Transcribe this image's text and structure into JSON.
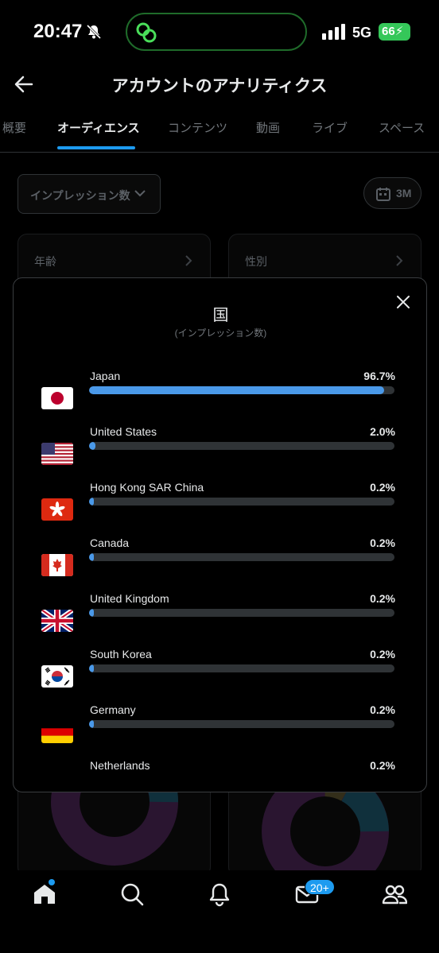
{
  "status_bar": {
    "time": "20:47",
    "network": "5G",
    "battery": "66"
  },
  "header": {
    "title": "アカウントのアナリティクス"
  },
  "tabs": [
    {
      "label": "概要"
    },
    {
      "label": "オーディエンス"
    },
    {
      "label": "コンテンツ"
    },
    {
      "label": "動画"
    },
    {
      "label": "ライブ"
    },
    {
      "label": "スペース"
    }
  ],
  "filters": {
    "metric": "インプレッション数",
    "range": "3M"
  },
  "cards": [
    {
      "title": "年齢"
    },
    {
      "title": "性別"
    }
  ],
  "modal": {
    "title": "国",
    "subtitle": "(インプレッション数)",
    "rows": [
      {
        "country": "Japan",
        "percent_label": "96.7%",
        "percent": 96.7,
        "flag": "japan-flag-icon"
      },
      {
        "country": "United States",
        "percent_label": "2.0%",
        "percent": 2.0,
        "flag": "us-flag-icon"
      },
      {
        "country": "Hong Kong SAR China",
        "percent_label": "0.2%",
        "percent": 0.2,
        "flag": "hong-kong-flag-icon"
      },
      {
        "country": "Canada",
        "percent_label": "0.2%",
        "percent": 0.2,
        "flag": "canada-flag-icon"
      },
      {
        "country": "United Kingdom",
        "percent_label": "0.2%",
        "percent": 0.2,
        "flag": "uk-flag-icon"
      },
      {
        "country": "South Korea",
        "percent_label": "0.2%",
        "percent": 0.2,
        "flag": "south-korea-flag-icon"
      },
      {
        "country": "Germany",
        "percent_label": "0.2%",
        "percent": 0.2,
        "flag": "germany-flag-icon"
      },
      {
        "country": "Netherlands",
        "percent_label": "0.2%",
        "percent": 0.2,
        "flag": "netherlands-flag-icon"
      }
    ]
  },
  "bottom_nav": {
    "messages_badge": "20+"
  },
  "colors": {
    "accent": "#1d9bf0",
    "bar_fill": "#4a99e9",
    "bar_track": "#2f3336"
  }
}
